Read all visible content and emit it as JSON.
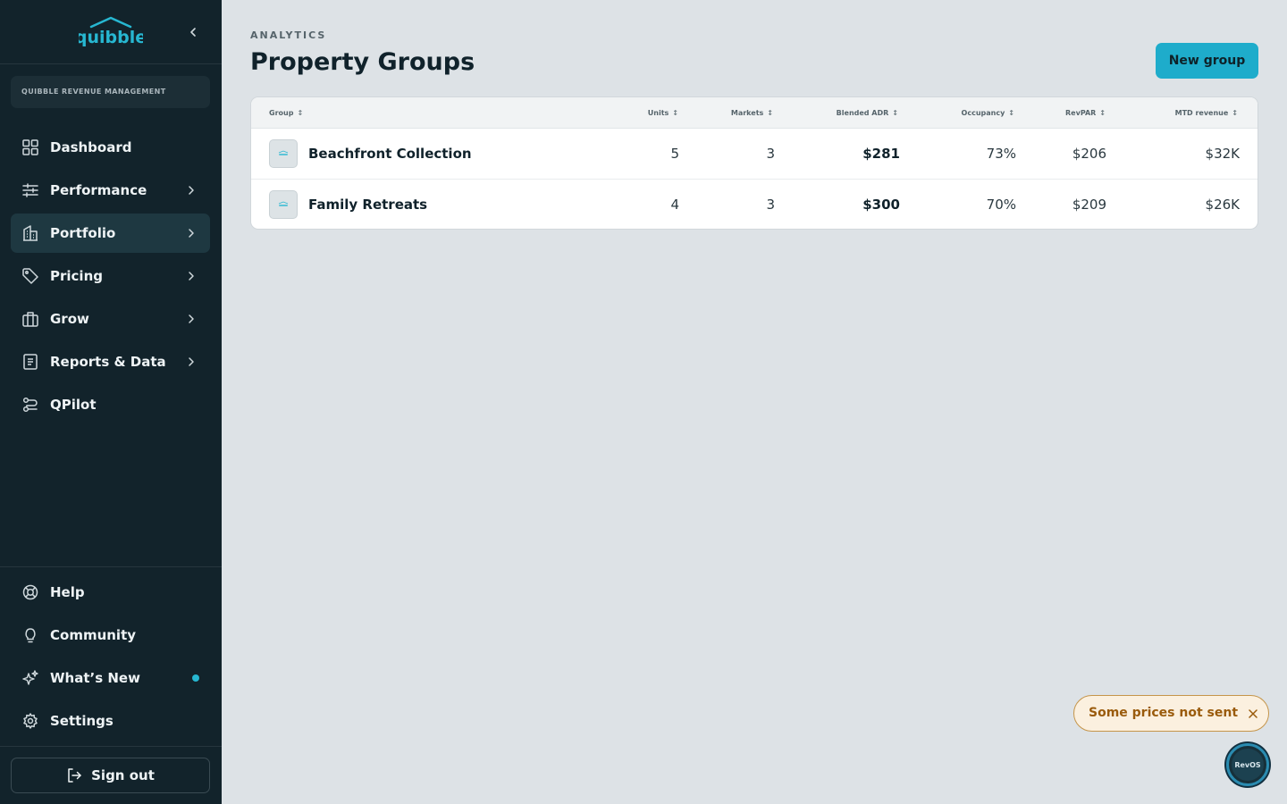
{
  "brand": {
    "logo_text": "quibble",
    "accent": "#27b7d1"
  },
  "sidebar": {
    "org_name": "QUIBBLE REVENUE MANAGEMENT",
    "items": [
      {
        "label": "Dashboard",
        "icon": "grid-icon"
      },
      {
        "label": "Performance",
        "icon": "sliders-icon"
      },
      {
        "label": "Portfolio",
        "icon": "building-icon",
        "active": true
      },
      {
        "label": "Pricing",
        "icon": "tag-icon"
      },
      {
        "label": "Grow",
        "icon": "briefcase-icon"
      },
      {
        "label": "Reports & Data",
        "icon": "report-icon"
      },
      {
        "label": "QPilot",
        "icon": "route-icon"
      }
    ],
    "bottom_items": [
      {
        "label": "Help",
        "icon": "lifebuoy-icon"
      },
      {
        "label": "Community",
        "icon": "lightbulb-icon"
      },
      {
        "label": "What’s New",
        "icon": "sparkle-icon"
      },
      {
        "label": "Settings",
        "icon": "gear-icon"
      }
    ],
    "sign_out": "Sign out"
  },
  "header": {
    "eyebrow": "ANALYTICS",
    "title": "Property Groups",
    "new_group": "New group"
  },
  "table": {
    "columns": [
      "Group",
      "Units",
      "Markets",
      "Blended ADR",
      "Occupancy",
      "RevPAR",
      "MTD revenue"
    ],
    "rows": [
      {
        "group": "Beachfront Collection",
        "units": "5",
        "markets": "3",
        "adr": "$281",
        "occupancy": "73%",
        "revpar": "$206",
        "mtd": "$32K"
      },
      {
        "group": "Family Retreats",
        "units": "4",
        "markets": "3",
        "adr": "$300",
        "occupancy": "70%",
        "revpar": "$209",
        "mtd": "$26K"
      }
    ]
  },
  "toast": {
    "text": "Some prices not sent"
  },
  "assistant": {
    "label": "RevOS"
  }
}
